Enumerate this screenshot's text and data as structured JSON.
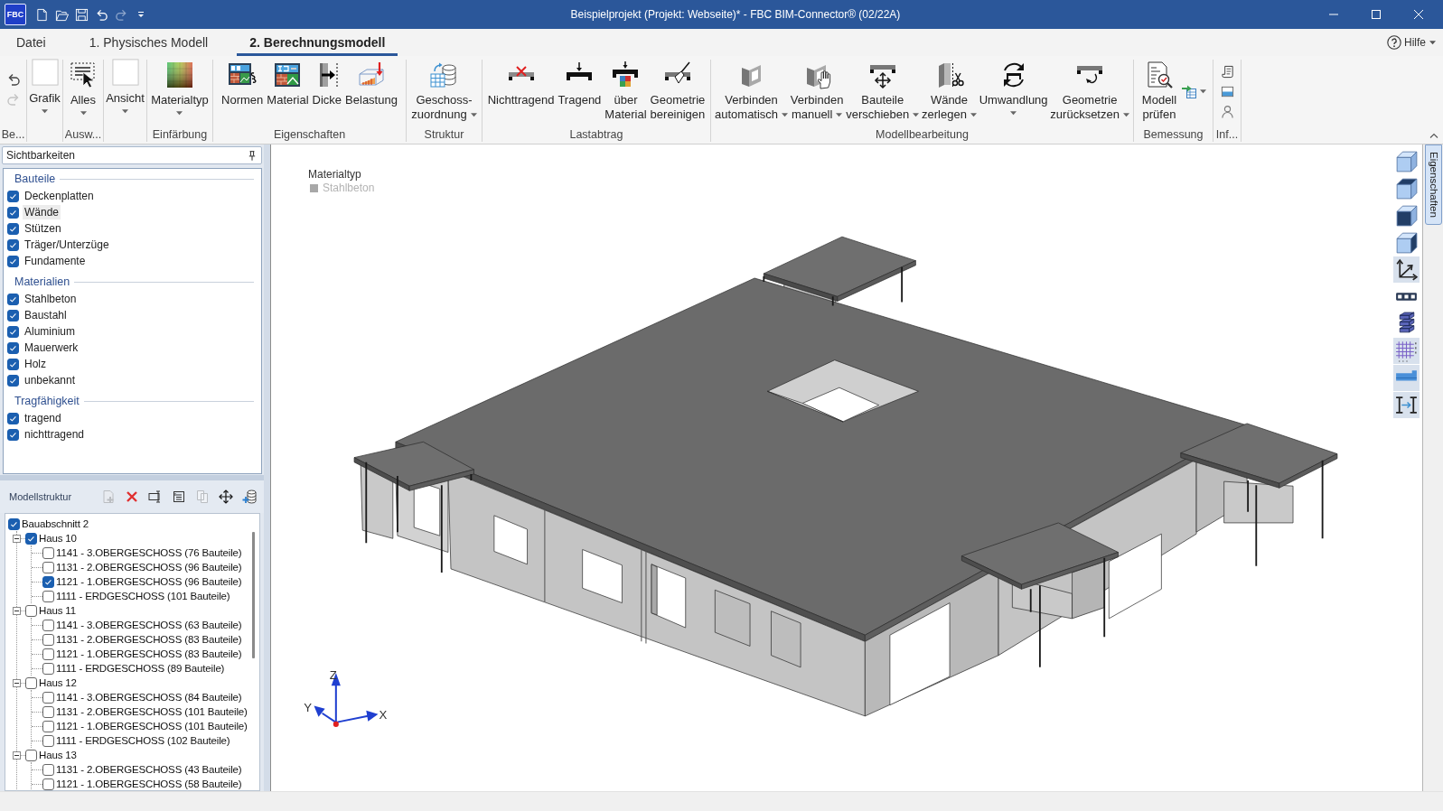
{
  "title_bar": {
    "logo": "FBC",
    "quick_access": [
      {
        "disabled": false
      },
      {
        "disabled": false
      },
      {
        "disabled": false
      },
      {
        "disabled": false
      },
      {
        "disabled": true
      },
      {
        "disabled": false
      }
    ],
    "title": "Beispielprojekt (Projekt: Webseite)* - FBC BIM-Connector® (02/22A)"
  },
  "ribbon": {
    "tabs": [
      {
        "label": "Datei",
        "selected": false
      },
      {
        "label": "1. Physisches Modell",
        "selected": false
      },
      {
        "label": "2. Berechnungsmodell",
        "selected": true
      }
    ],
    "help": {
      "label": "Hilfe",
      "dropdown": true
    },
    "groups": [
      {
        "label": "Be...",
        "buttons": [
          {
            "kind": "small",
            "dropdown": false,
            "disabled": false
          },
          {
            "kind": "small",
            "dropdown": false,
            "disabled": true
          }
        ]
      },
      {
        "buttons": [
          {
            "kind": "large",
            "label": "Grafik",
            "dropdown": true,
            "disabled": false
          }
        ]
      },
      {
        "label": "Ausw...",
        "buttons": [
          {
            "kind": "large",
            "label": "Alles",
            "dropdown": true,
            "disabled": false
          }
        ]
      },
      {
        "buttons": [
          {
            "kind": "large",
            "label": "Ansicht",
            "dropdown": true,
            "disabled": false
          }
        ]
      },
      {
        "label": "Einfärbung",
        "buttons": [
          {
            "kind": "large",
            "label": "Materialtyp",
            "dropdown": true,
            "disabled": false
          }
        ]
      },
      {
        "label": "Eigenschaften",
        "buttons": [
          {
            "kind": "large",
            "label": "Normen",
            "dropdown": false,
            "disabled": false
          },
          {
            "kind": "large",
            "label": "Material",
            "dropdown": false,
            "disabled": false
          },
          {
            "kind": "large",
            "label": "Dicke",
            "dropdown": false,
            "disabled": false
          },
          {
            "kind": "large",
            "label": "Belastung",
            "dropdown": false,
            "disabled": false
          }
        ]
      },
      {
        "label": "Struktur",
        "buttons": [
          {
            "kind": "large",
            "label": "Geschoss-\nzuordnung",
            "dropdown": true,
            "disabled": false
          }
        ]
      },
      {
        "label": "Lastabtrag",
        "buttons": [
          {
            "kind": "large",
            "label": "Nichttragend",
            "dropdown": false,
            "disabled": false
          },
          {
            "kind": "large",
            "label": "Tragend",
            "dropdown": false,
            "disabled": false
          },
          {
            "kind": "large",
            "label": "über\nMaterial",
            "dropdown": false,
            "disabled": false
          },
          {
            "kind": "large",
            "label": "Geometrie\nbereinigen",
            "dropdown": false,
            "disabled": false
          }
        ]
      },
      {
        "label": "Modellbearbeitung",
        "buttons": [
          {
            "kind": "large",
            "label": "Verbinden\nautomatisch",
            "dropdown": true,
            "disabled": false
          },
          {
            "kind": "large",
            "label": "Verbinden\nmanuell",
            "dropdown": true,
            "disabled": false
          },
          {
            "kind": "large",
            "label": "Bauteile\nverschieben",
            "dropdown": true,
            "disabled": false
          },
          {
            "kind": "large",
            "label": "Wände\nzerlegen",
            "dropdown": true,
            "disabled": false
          },
          {
            "kind": "large",
            "label": "Umwandlung",
            "dropdown": true,
            "disabled": false
          },
          {
            "kind": "large",
            "label": "Geometrie\nzurücksetzen",
            "dropdown": true,
            "disabled": false
          }
        ]
      },
      {
        "label": "Bemessung",
        "buttons": [
          {
            "kind": "large",
            "label": "Modell\nprüfen",
            "dropdown": false,
            "disabled": false
          },
          {
            "kind": "small",
            "dropdown": true,
            "disabled": false
          }
        ]
      },
      {
        "label": "Inf...",
        "buttons": [
          {
            "kind": "small",
            "dropdown": false,
            "disabled": false
          },
          {
            "kind": "small",
            "dropdown": false,
            "disabled": false
          },
          {
            "kind": "small",
            "dropdown": false,
            "disabled": false
          }
        ]
      }
    ]
  },
  "visibility": {
    "title": "Sichtbarkeiten",
    "sections": [
      {
        "heading": "Bauteile",
        "items": [
          {
            "label": "Deckenplatten",
            "checked": true,
            "highlighted": false
          },
          {
            "label": "Wände",
            "checked": true,
            "highlighted": true
          },
          {
            "label": "Stützen",
            "checked": true,
            "highlighted": false
          },
          {
            "label": "Träger/Unterzüge",
            "checked": true,
            "highlighted": false
          },
          {
            "label": "Fundamente",
            "checked": true,
            "highlighted": false
          }
        ]
      },
      {
        "heading": "Materialien",
        "items": [
          {
            "label": "Stahlbeton",
            "checked": true,
            "highlighted": false
          },
          {
            "label": "Baustahl",
            "checked": true,
            "highlighted": false
          },
          {
            "label": "Aluminium",
            "checked": true,
            "highlighted": false
          },
          {
            "label": "Mauerwerk",
            "checked": true,
            "highlighted": false
          },
          {
            "label": "Holz",
            "checked": true,
            "highlighted": false
          },
          {
            "label": "unbekannt",
            "checked": true,
            "highlighted": false
          }
        ]
      },
      {
        "heading": "Tragfähigkeit",
        "items": [
          {
            "label": "tragend",
            "checked": true,
            "highlighted": false
          },
          {
            "label": "nichttragend",
            "checked": true,
            "highlighted": false
          }
        ]
      }
    ]
  },
  "model_structure": {
    "title": "Modellstruktur",
    "toolbar": [
      {
        "disabled": true
      },
      {
        "disabled": false
      },
      {
        "disabled": false
      },
      {
        "disabled": false
      },
      {
        "disabled": true
      },
      {
        "disabled": false
      },
      {
        "disabled": false
      }
    ],
    "tree": [
      {
        "label": "Bauabschnitt 2",
        "checked": true,
        "children": [
          {
            "label": "Haus 10",
            "checked": true,
            "expanded": true,
            "children": [
              {
                "label": "1141 - 3.OBERGESCHOSS (76 Bauteile)",
                "checked": false
              },
              {
                "label": "1131 - 2.OBERGESCHOSS (96 Bauteile)",
                "checked": false
              },
              {
                "label": "1121 - 1.OBERGESCHOSS (96 Bauteile)",
                "checked": true
              },
              {
                "label": "1111 - ERDGESCHOSS (101 Bauteile)",
                "checked": false
              }
            ]
          },
          {
            "label": "Haus 11",
            "checked": false,
            "expanded": true,
            "children": [
              {
                "label": "1141 - 3.OBERGESCHOSS (63 Bauteile)",
                "checked": false
              },
              {
                "label": "1131 - 2.OBERGESCHOSS (83 Bauteile)",
                "checked": false
              },
              {
                "label": "1121 - 1.OBERGESCHOSS (83 Bauteile)",
                "checked": false
              },
              {
                "label": "1111 - ERDGESCHOSS (89 Bauteile)",
                "checked": false
              }
            ]
          },
          {
            "label": "Haus 12",
            "checked": false,
            "expanded": true,
            "children": [
              {
                "label": "1141 - 3.OBERGESCHOSS (84 Bauteile)",
                "checked": false
              },
              {
                "label": "1131 - 2.OBERGESCHOSS (101 Bauteile)",
                "checked": false
              },
              {
                "label": "1121 - 1.OBERGESCHOSS (101 Bauteile)",
                "checked": false
              },
              {
                "label": "1111 - ERDGESCHOSS (102 Bauteile)",
                "checked": false
              }
            ]
          },
          {
            "label": "Haus 13",
            "checked": false,
            "expanded": true,
            "children": [
              {
                "label": "1131 - 2.OBERGESCHOSS (43 Bauteile)",
                "checked": false
              },
              {
                "label": "1121 - 1.OBERGESCHOSS (58 Bauteile)",
                "checked": false
              }
            ]
          }
        ]
      }
    ]
  },
  "viewport": {
    "legend": {
      "title": "Materialtyp",
      "items": [
        {
          "label": "Stahlbeton",
          "color": "#a8a8a8"
        }
      ]
    },
    "axis_labels": [
      "Z",
      "Y",
      "X"
    ],
    "view_toolbar": [
      {
        "on": false
      },
      {
        "on": false
      },
      {
        "on": false
      },
      {
        "on": false
      },
      {
        "on": true
      },
      {
        "on": false
      },
      {
        "on": false
      },
      {
        "on": true
      },
      {
        "on": true
      },
      {
        "on": true
      }
    ]
  },
  "properties_tab": {
    "label": "Eigenschaften"
  }
}
